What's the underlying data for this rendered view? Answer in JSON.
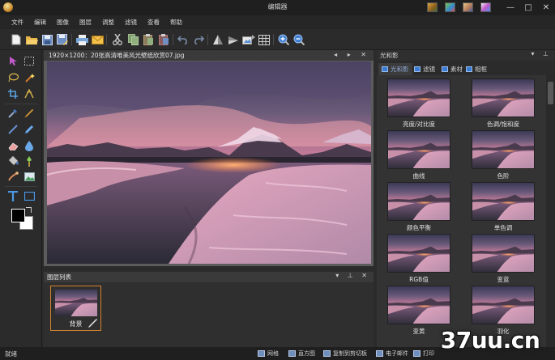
{
  "window": {
    "title": "编辑器",
    "controls": [
      "—",
      "□",
      "✕"
    ]
  },
  "menu": [
    "文件",
    "编辑",
    "图像",
    "图层",
    "调整",
    "滤镜",
    "查看",
    "帮助"
  ],
  "toolbar": {
    "items": [
      "new-file",
      "open-folder",
      "save",
      "save-as",
      "print",
      "email",
      "cut",
      "copy",
      "paste",
      "paste-layer",
      "undo",
      "redo",
      "flip",
      "rotate",
      "image-size",
      "grid",
      "zoom-in",
      "zoom-out"
    ]
  },
  "document": {
    "tab_label": "1920×1200：20张高清唯美风光壁纸欣赏07.jpg",
    "tab_controls": "◂ ▸ ✕"
  },
  "layers": {
    "title": "图层列表",
    "controls": "▾ ⊥ ✕",
    "items": [
      {
        "name": "背景"
      }
    ]
  },
  "right_panel": {
    "title": "光和影",
    "controls": "▾ ⊥",
    "tabs": [
      {
        "label": "光和影",
        "active": true
      },
      {
        "label": "滤镜",
        "active": false
      },
      {
        "label": "素材",
        "active": false
      },
      {
        "label": "相框",
        "active": false
      }
    ],
    "effects": [
      "亮度/对比度",
      "色调/饱和度",
      "曲线",
      "色阶",
      "颜色平衡",
      "单色调",
      "RGB值",
      "变蓝",
      "变黄",
      "羽化"
    ]
  },
  "status": {
    "text": "就绪",
    "items": [
      "网格",
      "直方图",
      "复制到剪切板",
      "电子邮件",
      "打印"
    ]
  },
  "watermark": "37uu.cn",
  "colors": {
    "accent": "#d2822e",
    "panel": "#333333",
    "tab_active_text": "#8fa8d8"
  }
}
